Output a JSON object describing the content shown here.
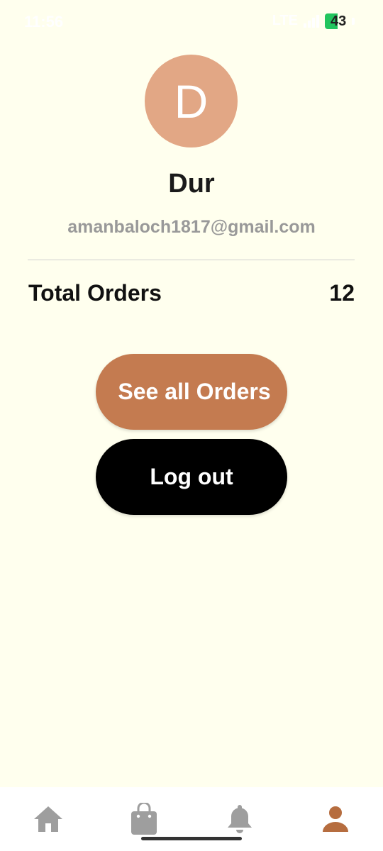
{
  "status_bar": {
    "time": "11:56",
    "network": "LTE",
    "battery": "43"
  },
  "profile": {
    "avatar_letter": "D",
    "name": "Dur",
    "email": "amanbaloch1817@gmail.com"
  },
  "orders": {
    "label": "Total Orders",
    "count": "12"
  },
  "buttons": {
    "see_all_orders": "See all Orders",
    "logout": "Log out"
  },
  "colors": {
    "background": "#FFFFEE",
    "accent": "#C47B50",
    "avatar": "#E2A785",
    "nav_inactive": "#9E9E9E",
    "nav_active": "#B66D3F"
  },
  "bottom_nav": {
    "items": [
      {
        "icon": "home-icon",
        "active": false
      },
      {
        "icon": "shopping-bag-icon",
        "active": false
      },
      {
        "icon": "bell-icon",
        "active": false
      },
      {
        "icon": "person-icon",
        "active": true
      }
    ]
  }
}
